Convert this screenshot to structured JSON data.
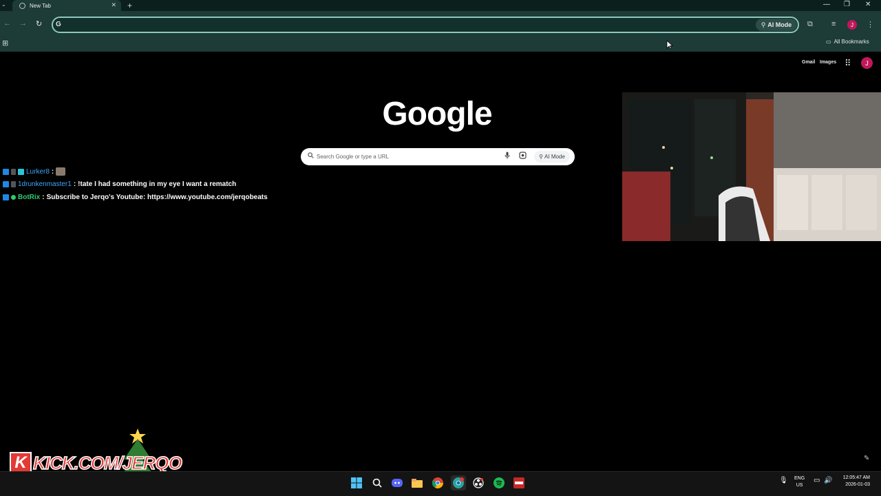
{
  "browser": {
    "tab_title": "New Tab",
    "omnibox_value": "",
    "omnibox_g": "G",
    "ai_mode_label": "AI Mode",
    "all_bookmarks_label": "All Bookmarks",
    "avatar_letter": "J",
    "accent_color": "#1d3b37"
  },
  "ntp": {
    "gmail_label": "Gmail",
    "images_label": "Images",
    "logo_text": "Google",
    "search_placeholder": "Search Google or type a URL",
    "ai_mode_label": "AI Mode",
    "avatar_letter": "J"
  },
  "chat": [
    {
      "user": "Lurker8",
      "separator": ":",
      "message": "",
      "user_color": "#3ea6ff"
    },
    {
      "user": "1drunkenmaster1",
      "separator": ":",
      "message": "!tate I had something in my eye I want a rematch",
      "user_color": "#3ea6ff"
    },
    {
      "user": "BotRix",
      "separator": ":",
      "message": "Subscribe to Jerqo's Youtube: https://www.youtube.com/jerqobeats",
      "user_color": "#2ecc71"
    }
  ],
  "overlay": {
    "kick_letter": "K",
    "kick_text": "KICK.COM/JERQO"
  },
  "taskbar": {
    "lang_line1": "ENG",
    "lang_line2": "US",
    "time": "12:05:47 AM",
    "date": "2026-01-03"
  }
}
